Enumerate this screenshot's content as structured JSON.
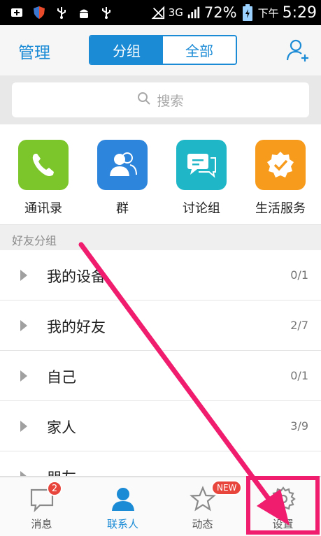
{
  "status_bar": {
    "network": "3G",
    "battery_percent": "72%",
    "time_period": "下午",
    "time": "5:29"
  },
  "header": {
    "manage_label": "管理",
    "segments": [
      {
        "label": "分组",
        "active": true
      },
      {
        "label": "全部",
        "active": false
      }
    ],
    "add_icon": "add-friend-icon"
  },
  "search": {
    "placeholder": "搜索"
  },
  "tiles": [
    {
      "label": "通讯录",
      "icon": "phone-icon",
      "color": "#7cc52a"
    },
    {
      "label": "群",
      "icon": "group-icon",
      "color": "#2e86dc"
    },
    {
      "label": "讨论组",
      "icon": "discussion-icon",
      "color": "#1fb7c7"
    },
    {
      "label": "生活服务",
      "icon": "service-badge-icon",
      "color": "#f79b1d"
    }
  ],
  "section": {
    "title": "好友分组"
  },
  "groups": [
    {
      "name": "我的设备",
      "count": "0/1"
    },
    {
      "name": "我的好友",
      "count": "2/7"
    },
    {
      "name": "自己",
      "count": "0/1"
    },
    {
      "name": "家人",
      "count": "3/9"
    },
    {
      "name": "朋友",
      "count": ""
    }
  ],
  "tabbar": {
    "tabs": [
      {
        "label": "消息",
        "icon": "message-icon",
        "badge": "2",
        "active": false
      },
      {
        "label": "联系人",
        "icon": "contact-icon",
        "active": true
      },
      {
        "label": "动态",
        "icon": "star-icon",
        "badge": "NEW",
        "active": false
      },
      {
        "label": "设置",
        "icon": "gear-icon",
        "active": false
      }
    ]
  },
  "colors": {
    "accent": "#1b8bd6",
    "annotation": "#f01d6e",
    "badge": "#e8453c"
  }
}
